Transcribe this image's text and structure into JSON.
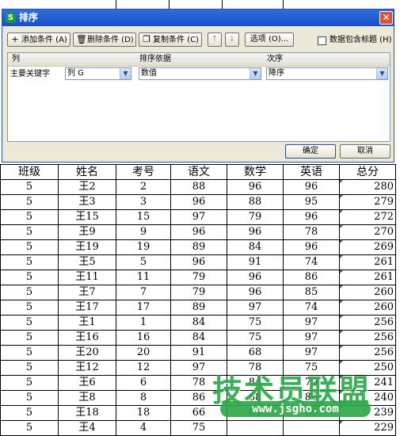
{
  "dialog": {
    "title": "排序",
    "app_icon": "S",
    "close_glyph": "✕",
    "toolbar": {
      "add_label": "添加条件 (A)",
      "delete_label": "删除条件 (D)",
      "copy_label": "复制条件 (C)",
      "up_glyph": "↑",
      "down_glyph": "↓",
      "options_label": "选项 (O)...",
      "header_checkbox_label": "数据包含标题 (H)"
    },
    "columns": {
      "col": "列",
      "basis": "排序依据",
      "order": "次序"
    },
    "condition": {
      "label": "主要关键字",
      "column_value": "列 G",
      "basis_value": "数值",
      "order_value": "降序"
    },
    "ok_label": "确定",
    "cancel_label": "取消"
  },
  "sheet": {
    "headers": [
      "班级",
      "姓名",
      "考号",
      "语文",
      "数学",
      "英语",
      "总分"
    ],
    "rows": [
      [
        "5",
        "王2",
        "2",
        "88",
        "96",
        "96",
        "280"
      ],
      [
        "5",
        "王3",
        "3",
        "96",
        "88",
        "95",
        "279"
      ],
      [
        "5",
        "王15",
        "15",
        "97",
        "79",
        "96",
        "272"
      ],
      [
        "5",
        "王9",
        "9",
        "96",
        "96",
        "78",
        "270"
      ],
      [
        "5",
        "王19",
        "19",
        "89",
        "84",
        "96",
        "269"
      ],
      [
        "5",
        "王5",
        "5",
        "96",
        "91",
        "74",
        "261"
      ],
      [
        "5",
        "王11",
        "11",
        "79",
        "96",
        "86",
        "261"
      ],
      [
        "5",
        "王7",
        "7",
        "79",
        "96",
        "85",
        "260"
      ],
      [
        "5",
        "王17",
        "17",
        "89",
        "97",
        "74",
        "260"
      ],
      [
        "5",
        "王1",
        "1",
        "84",
        "75",
        "97",
        "256"
      ],
      [
        "5",
        "王16",
        "16",
        "84",
        "75",
        "97",
        "256"
      ],
      [
        "5",
        "王20",
        "20",
        "91",
        "68",
        "97",
        "256"
      ],
      [
        "5",
        "王12",
        "12",
        "97",
        "78",
        "75",
        "250"
      ],
      [
        "5",
        "王6",
        "6",
        "78",
        "84",
        "79",
        "241"
      ],
      [
        "5",
        "王8",
        "8",
        "86",
        "68",
        "86",
        "240"
      ],
      [
        "5",
        "王18",
        "18",
        "66",
        "84",
        "89",
        "239"
      ],
      [
        "5",
        "王4",
        "4",
        "75",
        "",
        "",
        "229"
      ]
    ]
  },
  "watermark": {
    "title": "技术员联盟",
    "url": "www.jsgho.com"
  },
  "colors": {
    "title_bar": "#1a4fc4",
    "close_button": "#d9543b",
    "watermark": "#2fa84a",
    "number_marker": "#1f7a2e"
  }
}
